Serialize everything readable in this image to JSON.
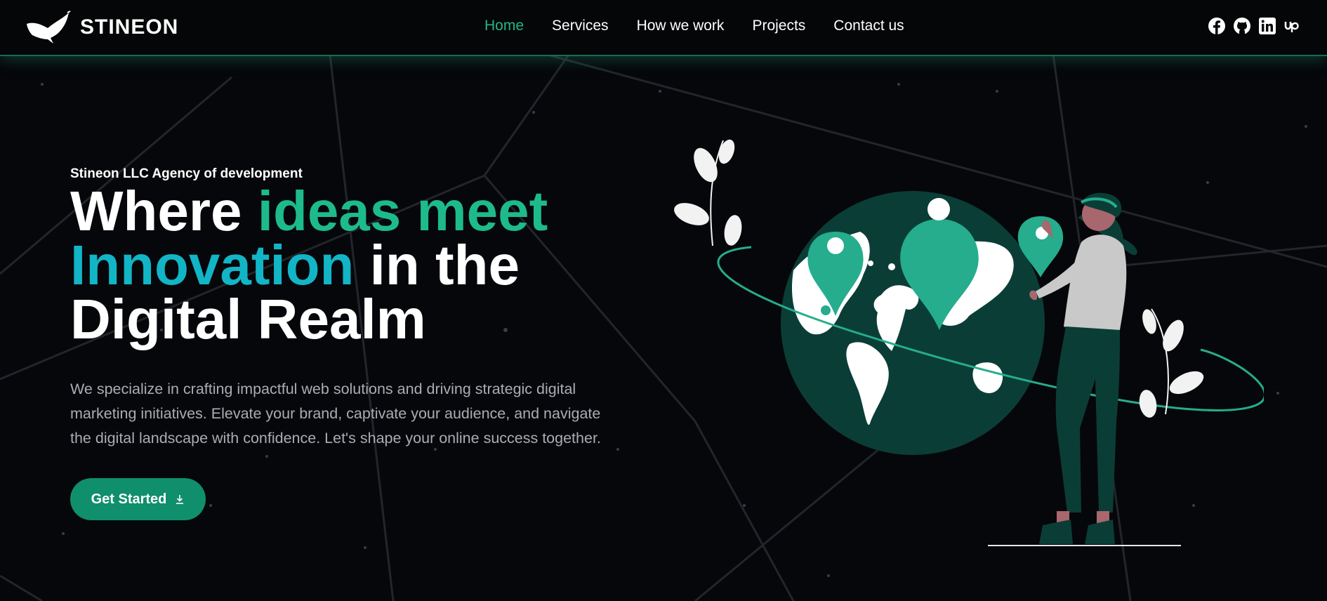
{
  "header": {
    "brand": "STINEON",
    "nav": [
      {
        "label": "Home",
        "active": true
      },
      {
        "label": "Services",
        "active": false
      },
      {
        "label": "How we work",
        "active": false
      },
      {
        "label": "Projects",
        "active": false
      },
      {
        "label": "Contact us",
        "active": false
      }
    ],
    "social_icons": [
      "facebook-icon",
      "github-icon",
      "linkedin-icon",
      "upwork-icon"
    ]
  },
  "hero": {
    "eyebrow": "Stineon LLC Agency of development",
    "headline": {
      "part1": "Where ",
      "part2": "ideas meet",
      "part3": "Innovation",
      "part4": " in the",
      "part5": "Digital Realm"
    },
    "description": "We specialize in crafting impactful web solutions and driving strategic digital marketing initiatives. Elevate your brand, captivate your audience, and navigate the digital landscape with confidence. Let's shape your online success together.",
    "cta_label": "Get Started"
  },
  "colors": {
    "background": "#06070a",
    "accent_green": "#1dbb8c",
    "accent_teal": "#12b5c6",
    "button": "#0f8f6c",
    "globe": "#0b3d37"
  }
}
